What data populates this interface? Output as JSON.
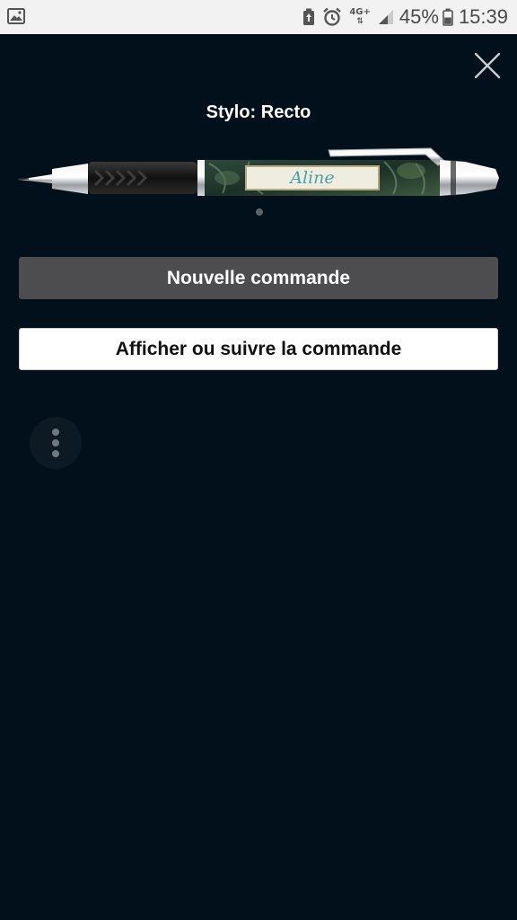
{
  "status_bar": {
    "network": "4G+",
    "battery_percent": "45%",
    "time": "15:39",
    "icons": [
      "image-icon",
      "battery-saver-icon",
      "alarm-icon",
      "network-4g-icon",
      "signal-icon",
      "battery-icon"
    ]
  },
  "header": {
    "title": "Stylo: Recto",
    "close_icon": "close-icon"
  },
  "product": {
    "pen_name": "Aline",
    "carousel_pages": 1,
    "carousel_active": 1
  },
  "actions": {
    "new_order": "Nouvelle commande",
    "view_order": "Afficher ou suivre la commande"
  },
  "more_menu": {
    "icon": "more-vertical-icon"
  },
  "colors": {
    "background": "#02101b",
    "primary_button": "#4d4d4f",
    "secondary_button": "#ffffff"
  }
}
